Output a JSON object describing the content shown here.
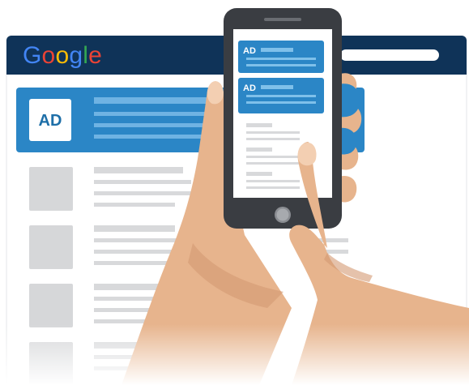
{
  "browser": {
    "logo": {
      "text": "Google",
      "letters": [
        {
          "char": "G",
          "color": "#4285F4"
        },
        {
          "char": "o",
          "color": "#EA4335"
        },
        {
          "char": "o",
          "color": "#FBBC05"
        },
        {
          "char": "g",
          "color": "#4285F4"
        },
        {
          "char": "l",
          "color": "#34A853"
        },
        {
          "char": "e",
          "color": "#EA4335"
        }
      ]
    },
    "header_color": "#0F3358"
  },
  "desktop_ad": {
    "badge": "AD",
    "color": "#2B86C6"
  },
  "phone": {
    "ads": [
      {
        "badge": "AD"
      },
      {
        "badge": "AD"
      }
    ],
    "frame_color": "#3A3D42",
    "ad_color": "#2B86C6"
  },
  "colors": {
    "skin": "#E7B48D",
    "skin_shadow": "#D49A73",
    "placeholder": "#D6D7D9",
    "line": "#D8D9DB"
  }
}
